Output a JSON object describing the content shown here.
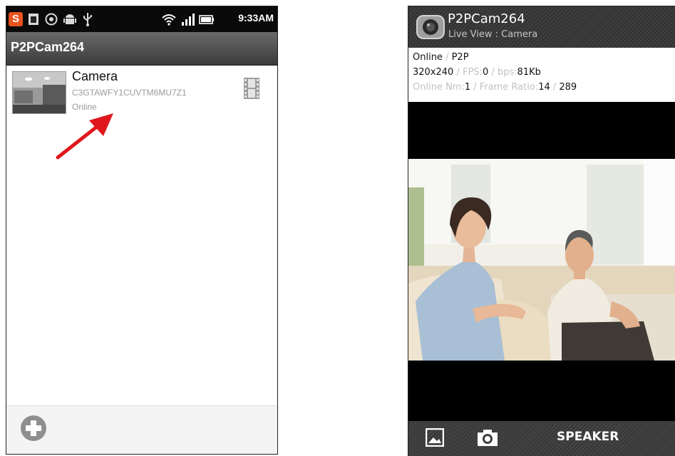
{
  "left_screen": {
    "status_bar": {
      "time": "9:33AM",
      "app_icon_letter": "S",
      "icons": [
        "app-notification-icon",
        "usb-storage-icon",
        "headset-icon",
        "android-debug-icon",
        "usb-icon",
        "wifi-icon",
        "signal-icon",
        "battery-icon"
      ]
    },
    "app_bar": {
      "title": "P2PCam264"
    },
    "camera_list": [
      {
        "name": "Camera",
        "uid": "C3GTAWFY1CUVTM6MU7Z1",
        "status": "Online",
        "icon": "film-strip-icon"
      }
    ],
    "bottom_bar": {
      "add_icon": "add-circle-icon"
    },
    "annotation": {
      "color": "#e0181d",
      "icon": "red-arrow-annotation"
    }
  },
  "right_screen": {
    "header": {
      "title": "P2PCam264",
      "subtitle": "Live View : Camera"
    },
    "info": {
      "status": "Online",
      "separator": " / ",
      "mode": "P2P",
      "resolution": "320x240",
      "fps_label": "FPS:",
      "fps_value": "0",
      "bps_label": "bps:",
      "bps_value": "81Kb",
      "online_nm_label": "Online Nm:",
      "online_nm_value": "1",
      "frame_ratio_label": "Frame Ratio:",
      "frame_ratio_value": "14",
      "frame_total": "289"
    },
    "bottom_bar": {
      "gallery_icon": "gallery-icon",
      "snapshot_icon": "camera-icon",
      "speaker_label": "SPEAKER"
    }
  },
  "colors": {
    "status_bar_bg": "#0a0a0a",
    "app_bar_bg": "#4f4f4f",
    "muted_text": "#9a9a9a",
    "info_label": "#c2c2c2",
    "video_bg": "#000000",
    "annotation_red": "#e0181d"
  }
}
